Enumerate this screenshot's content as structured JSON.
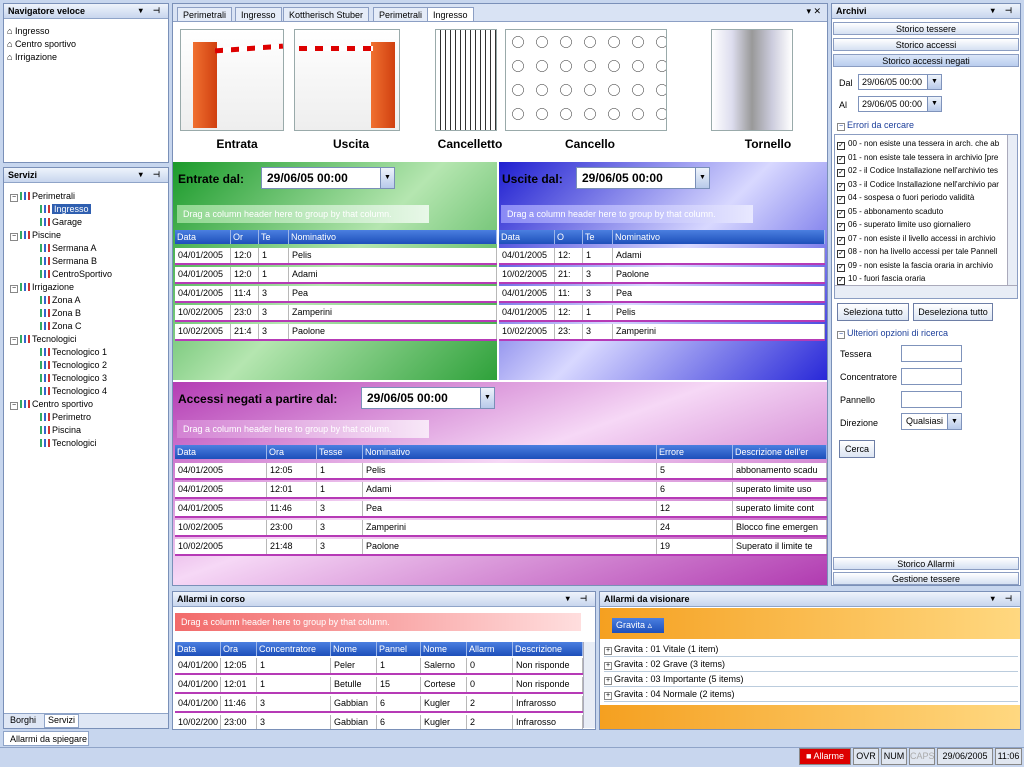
{
  "nav_panel": {
    "title": "Navigatore veloce",
    "items": [
      "Ingresso",
      "Centro sportivo",
      "Irrigazione"
    ]
  },
  "servizi": {
    "title": "Servizi",
    "tree": [
      {
        "label": "Perimetrali",
        "children": [
          "Ingresso",
          "Garage"
        ]
      },
      {
        "label": "Piscine",
        "children": [
          "Sermana A",
          "Sermana B",
          "CentroSportivo"
        ]
      },
      {
        "label": "Irrigazione",
        "children": [
          "Zona A",
          "Zona B",
          "Zona C"
        ]
      },
      {
        "label": "Tecnologici",
        "children": [
          "Tecnologico 1",
          "Tecnologico 2",
          "Tecnologico 3",
          "Tecnologico 4"
        ]
      },
      {
        "label": "Centro sportivo",
        "children": [
          "Perimetro",
          "Piscina",
          "Tecnologici"
        ]
      }
    ],
    "selected": "Ingresso",
    "bottom_tabs": [
      "Borghi",
      "Servizi"
    ]
  },
  "bottom_tab": "Allarmi da spiegare",
  "doc_tabs": [
    "Perimetrali",
    "Ingresso",
    "Kottherisch Stuber",
    "Perimetrali",
    "Ingresso"
  ],
  "devices": [
    "Entrata",
    "Uscita",
    "Cancelletto",
    "Cancello",
    "Tornello"
  ],
  "group_hint": "Drag a column header here to group by that column.",
  "entrate": {
    "label": "Entrate dal:",
    "date": "29/06/05 00:00",
    "columns": [
      "Data",
      "Or",
      "Te",
      "Nominativo"
    ],
    "rows": [
      [
        "04/01/2005",
        "12:0",
        "1",
        "Pelis"
      ],
      [
        "04/01/2005",
        "12:0",
        "1",
        "Adami"
      ],
      [
        "04/01/2005",
        "11:4",
        "3",
        "Pea"
      ],
      [
        "10/02/2005",
        "23:0",
        "3",
        "Zamperini"
      ],
      [
        "10/02/2005",
        "21:4",
        "3",
        "Paolone"
      ]
    ]
  },
  "uscite": {
    "label": "Uscite dal:",
    "date": "29/06/05 00:00",
    "columns": [
      "Data",
      "O",
      "Te",
      "Nominativo"
    ],
    "rows": [
      [
        "04/01/2005",
        "12:",
        "1",
        "Adami"
      ],
      [
        "10/02/2005",
        "21:",
        "3",
        "Paolone"
      ],
      [
        "04/01/2005",
        "11:",
        "3",
        "Pea"
      ],
      [
        "04/01/2005",
        "12:",
        "1",
        "Pelis"
      ],
      [
        "10/02/2005",
        "23:",
        "3",
        "Zamperini"
      ]
    ]
  },
  "negati": {
    "label": "Accessi negati a partire dal:",
    "date": "29/06/05 00:00",
    "columns": [
      "Data",
      "Ora",
      "Tesse",
      "Nominativo",
      "Errore",
      "Descrizione dell'er"
    ],
    "rows": [
      [
        "04/01/2005",
        "12:05",
        "1",
        "Pelis",
        "5",
        "abbonamento scadu"
      ],
      [
        "04/01/2005",
        "12:01",
        "1",
        "Adami",
        "6",
        "superato limite uso"
      ],
      [
        "04/01/2005",
        "11:46",
        "3",
        "Pea",
        "12",
        "superato limite cont"
      ],
      [
        "10/02/2005",
        "23:00",
        "3",
        "Zamperini",
        "24",
        "Blocco fine emergen"
      ],
      [
        "10/02/2005",
        "21:48",
        "3",
        "Paolone",
        "19",
        "Superato il limite te"
      ]
    ]
  },
  "allarmi_corso": {
    "title": "Allarmi in corso",
    "columns": [
      "Data",
      "Ora",
      "Concentratore",
      "Nome",
      "Pannel",
      "Nome",
      "Allarm",
      "Descrizione"
    ],
    "rows": [
      [
        "04/01/200",
        "12:05",
        "1",
        "Peler",
        "1",
        "Salerno",
        "0",
        "Non risponde"
      ],
      [
        "04/01/200",
        "12:01",
        "1",
        "Betulle",
        "15",
        "Cortese",
        "0",
        "Non risponde"
      ],
      [
        "04/01/200",
        "11:46",
        "3",
        "Gabbian",
        "6",
        "Kugler",
        "2",
        "Infrarosso"
      ],
      [
        "10/02/200",
        "23:00",
        "3",
        "Gabbian",
        "6",
        "Kugler",
        "2",
        "Infrarosso"
      ]
    ]
  },
  "allarmi_visionare": {
    "title": "Allarmi da visionare",
    "group_button": "Gravita",
    "groups": [
      "Gravita : 01 Vitale (1 item)",
      "Gravita : 02 Grave (3 items)",
      "Gravita : 03 Importante (5 items)",
      "Gravita : 04 Normale (2 items)"
    ]
  },
  "archivi": {
    "title": "Archivi",
    "buttons_top": [
      "Storico tessere",
      "Storico accessi",
      "Storico accessi negati"
    ],
    "dal_label": "Dal",
    "dal_value": "29/06/05 00:00",
    "al_label": "Al",
    "al_value": "29/06/05 00:00",
    "errori_title": "Errori da cercare",
    "errori": [
      "00 - non esiste una tessera in arch. che ab",
      "01 - non esiste tale tessera in archivio [pre",
      "02 - il Codice Installazione nell'archivio tes",
      "03 - il Codice Installazione nell'archivio par",
      "04 - sospesa o fuori periodo validità",
      "05 - abbonamento scaduto",
      "06 - superato limite uso giornaliero",
      "07 - non esiste il livello accessi in archivio",
      "08 - non ha livello accessi per tale Pannell",
      "09 - non esiste la fascia oraria in archivio",
      "10 - fuori fascia oraria"
    ],
    "seleziona": "Seleziona tutto",
    "deseleziona": "Deseleziona tutto",
    "ulteriori_title": "Ulteriori opzioni di ricerca",
    "fields": [
      "Tessera",
      "Concentratore",
      "Pannello"
    ],
    "direzione_label": "Direzione",
    "direzione_value": "Qualsiasi",
    "cerca": "Cerca",
    "buttons_bottom": [
      "Storico Allarmi",
      "Gestione tessere"
    ]
  },
  "statusbar": {
    "alarm": "Allarme",
    "ovr": "OVR",
    "num": "NUM",
    "caps": "CAPS",
    "date": "29/06/2005",
    "time": "11:06"
  }
}
